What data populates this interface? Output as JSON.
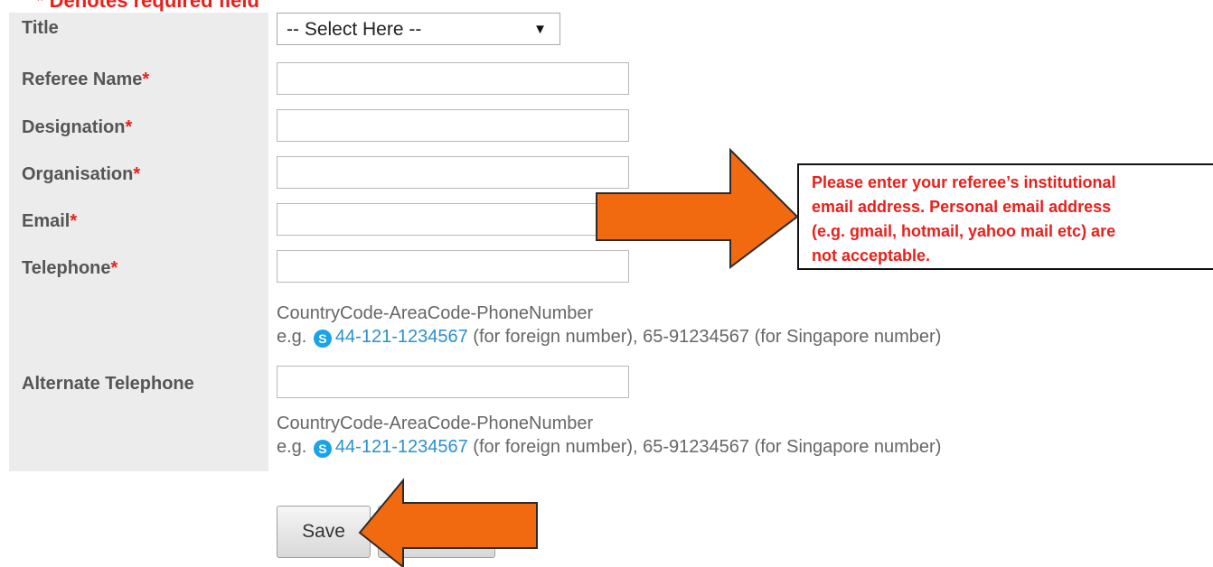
{
  "form": {
    "required_note": "* Denotes required field",
    "title_label": "Title",
    "title_select_value": "-- Select Here --",
    "referee_name_label": "Referee Name",
    "designation_label": "Designation",
    "organisation_label": "Organisation",
    "email_label": "Email",
    "telephone_label": "Telephone",
    "alternate_telephone_label": "Alternate Telephone",
    "required_marker": "*",
    "phone_format": "CountryCode-AreaCode-PhoneNumber",
    "phone_example_prefix": "e.g.",
    "phone_example_link": "44-121-1234567",
    "phone_example_suffix": "(for foreign number), 65-91234567 (for Singapore number)",
    "skype_icon_glyph": "S"
  },
  "buttons": {
    "save_label": "Save"
  },
  "callout": {
    "lines": [
      "Please enter your referee’s institutional",
      "email address. Personal email address",
      "(e.g. gmail, hotmail, yahoo mail etc) are",
      "not acceptable."
    ]
  },
  "colors": {
    "required": "#e8201b",
    "label_background": "#ececec",
    "link": "#2a90d0",
    "arrow_fill": "#f26a10"
  },
  "icons": [
    "skype-icon",
    "dropdown-arrow-icon"
  ]
}
